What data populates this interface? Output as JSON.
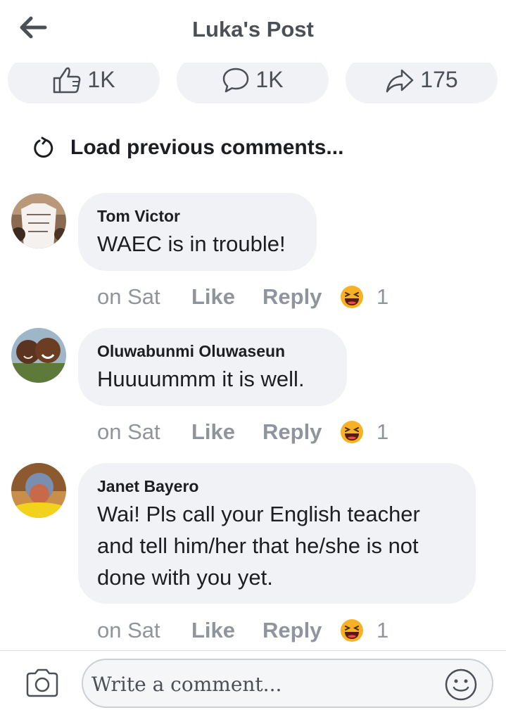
{
  "header": {
    "title": "Luka's Post",
    "back_icon": "arrow-left-icon"
  },
  "stats": {
    "likes": {
      "icon": "thumbs-up-icon",
      "count": "1K"
    },
    "comments": {
      "icon": "speech-bubble-icon",
      "count": "1K"
    },
    "shares": {
      "icon": "share-arrow-icon",
      "count": "175"
    }
  },
  "load_previous": {
    "icon": "refresh-icon",
    "label": "Load previous comments..."
  },
  "comments": [
    {
      "author": "Tom Victor",
      "text": "WAEC is in trouble!",
      "time": "on Sat",
      "like_label": "Like",
      "reply_label": "Reply",
      "reaction_icon": "laughing-emoji-icon",
      "reaction_count": "1"
    },
    {
      "author": "Oluwabunmi Oluwaseun",
      "text": "Huuuummm it is well.",
      "time": "on Sat",
      "like_label": "Like",
      "reply_label": "Reply",
      "reaction_icon": "laughing-emoji-icon",
      "reaction_count": "1"
    },
    {
      "author": "Janet Bayero",
      "text_lines": [
        "Wai! Pls call your English teacher",
        "and tell him/her that he/she is not",
        "done with you yet."
      ],
      "time": "on Sat",
      "like_label": "Like",
      "reply_label": "Reply",
      "reaction_icon": "laughing-emoji-icon",
      "reaction_count": "1"
    }
  ],
  "composer": {
    "camera_icon": "camera-icon",
    "placeholder": "Write a comment...",
    "emoji_icon": "smiley-icon"
  },
  "colors": {
    "bubble": "#f0f2f5",
    "muted_text": "#90949c",
    "header_text": "#4b4f56",
    "reaction": "#f7b125"
  }
}
